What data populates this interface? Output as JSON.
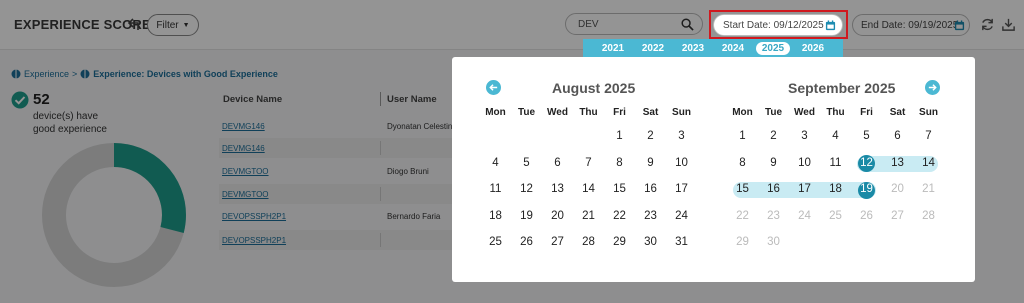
{
  "header": {
    "title": "EXPERIENCE SCORE",
    "filter_label": "Filter",
    "search_value": "DEV",
    "start_date": "Start Date: 09/12/2025",
    "end_date": "End Date: 09/19/2025"
  },
  "breadcrumb": {
    "root": "Experience",
    "sep": ">",
    "current": "Experience: Devices with Good Experience"
  },
  "summary": {
    "count": "52",
    "label_line1": "device(s) have",
    "label_line2": "good experience",
    "good_share": 0.29
  },
  "table": {
    "columns": [
      "Device Name",
      "User Name"
    ],
    "rows": [
      {
        "device": "DEVMG146",
        "user": "Dyonatan Celestin"
      },
      {
        "device": "DEVMG146",
        "user": ""
      },
      {
        "device": "DEVMGTOO",
        "user": "Diogo Bruni"
      },
      {
        "device": "DEVMGTOO",
        "user": ""
      },
      {
        "device": "DEVOPSSPH2P1",
        "user": "Bernardo Faria"
      },
      {
        "device": "DEVOPSSPH2P1",
        "user": ""
      }
    ]
  },
  "datepicker": {
    "years": [
      "2021",
      "2022",
      "2023",
      "2024",
      "2025",
      "2026"
    ],
    "selected_year": "2025",
    "weekdays": [
      "Mon",
      "Tue",
      "Wed",
      "Thu",
      "Fri",
      "Sat",
      "Sun"
    ],
    "left_month": {
      "title": "August 2025",
      "weeks": [
        [
          "",
          "",
          "",
          "",
          "1",
          "2",
          "3"
        ],
        [
          "4",
          "5",
          "6",
          "7",
          "8",
          "9",
          "10"
        ],
        [
          "11",
          "12",
          "13",
          "14",
          "15",
          "16",
          "17"
        ],
        [
          "18",
          "19",
          "20",
          "21",
          "22",
          "23",
          "24"
        ],
        [
          "25",
          "26",
          "27",
          "28",
          "29",
          "30",
          "31"
        ]
      ]
    },
    "right_month": {
      "title": "September 2025",
      "weeks": [
        [
          "1",
          "2",
          "3",
          "4",
          "5",
          "6",
          "7"
        ],
        [
          "8",
          "9",
          "10",
          "11",
          "12",
          "13",
          "14"
        ],
        [
          "15",
          "16",
          "17",
          "18",
          "19",
          "20",
          "21"
        ],
        [
          "22",
          "23",
          "24",
          "25",
          "26",
          "27",
          "28"
        ],
        [
          "29",
          "30",
          "",
          "",
          "",
          "",
          ""
        ]
      ],
      "range_start": "12",
      "range_end": "19",
      "disabled_after": "19"
    },
    "colors": {
      "accent": "#4bb8d3",
      "selected": "#1a8aa6",
      "range": "#c9ebf3"
    }
  }
}
